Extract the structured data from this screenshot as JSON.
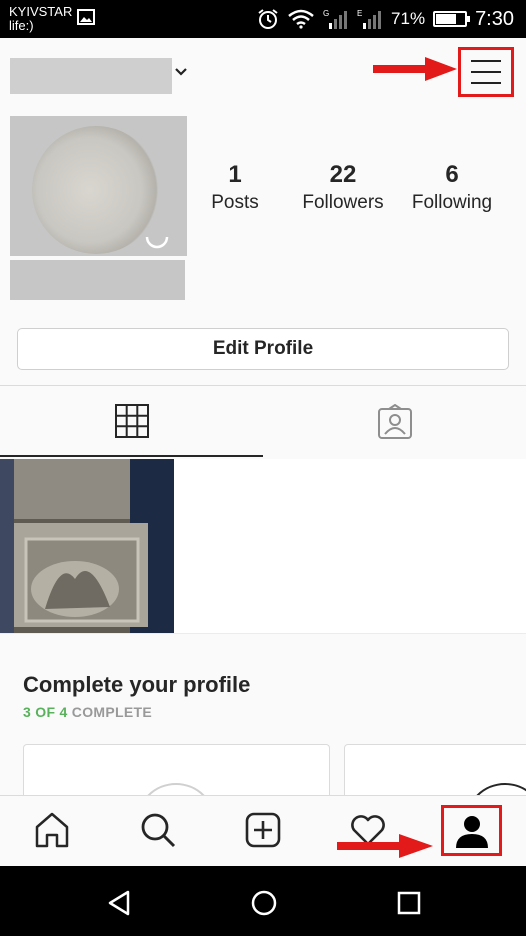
{
  "status_bar": {
    "carrier_line1": "KYIVSTAR",
    "carrier_line2": "life:)",
    "battery_percent": "71%",
    "battery_level": 0.71,
    "time": "7:30",
    "icons": [
      "image-icon",
      "alarm-icon",
      "wifi-icon",
      "signal-icon",
      "battery-icon"
    ]
  },
  "header": {
    "username_chevron_icon": "chevron-down-icon",
    "menu_icon": "hamburger-menu-icon",
    "annotation_color": "#e21a1a"
  },
  "profile": {
    "stats": [
      {
        "value": "1",
        "label": "Posts"
      },
      {
        "value": "22",
        "label": "Followers"
      },
      {
        "value": "6",
        "label": "Following"
      }
    ],
    "edit_button_label": "Edit Profile"
  },
  "tabs": [
    {
      "icon": "grid-icon",
      "active": true
    },
    {
      "icon": "tagged-photos-icon",
      "active": false
    }
  ],
  "complete_profile": {
    "title": "Complete your profile",
    "progress_done": "3 OF 4",
    "progress_suffix": " COMPLETE",
    "done_color": "#58b25b"
  },
  "bottom_nav": [
    {
      "icon": "home-icon"
    },
    {
      "icon": "search-icon"
    },
    {
      "icon": "add-post-icon"
    },
    {
      "icon": "heart-icon"
    },
    {
      "icon": "profile-icon"
    }
  ],
  "system_nav": [
    {
      "icon": "back-icon"
    },
    {
      "icon": "home-circle-icon"
    },
    {
      "icon": "recents-icon"
    }
  ]
}
